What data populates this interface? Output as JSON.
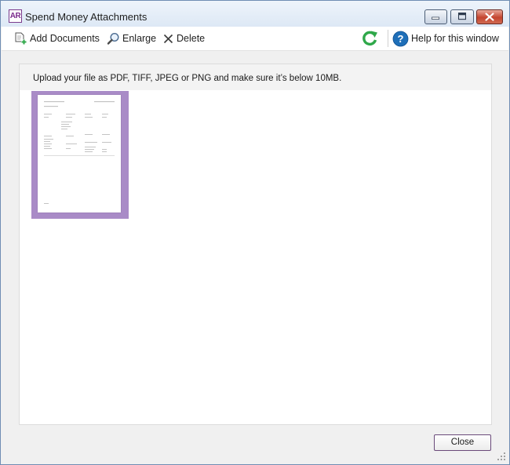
{
  "window": {
    "logo_text": "AR",
    "title": "Spend Money Attachments"
  },
  "toolbar": {
    "add_label": "Add Documents",
    "enlarge_label": "Enlarge",
    "delete_label": "Delete",
    "help_label": "Help for this window",
    "refresh_icon": "refresh-icon",
    "help_icon": "help-icon"
  },
  "panel": {
    "instruction": "Upload your file as PDF, TIFF, JPEG or PNG and make sure it’s below 10MB.",
    "attachments": [
      {
        "type": "document-thumbnail",
        "selected": true
      }
    ]
  },
  "footer": {
    "close_label": "Close"
  },
  "colors": {
    "thumbnail_selection": "#a98bc7",
    "refresh_green": "#2fa84a",
    "help_blue": "#1f6fb8",
    "logo_purple": "#7a2a8c"
  }
}
